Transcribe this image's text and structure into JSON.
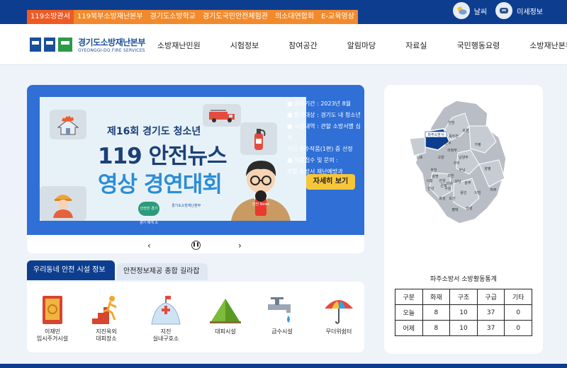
{
  "top_links": [
    "119소방관서",
    "119북부소방재난본부",
    "경기도소방학교",
    "경기도국민안전체험관",
    "의소대연합회",
    "E-교육영상"
  ],
  "weather": {
    "label": "날씨",
    "dust_label": "미세정보"
  },
  "logo": {
    "name": "경기도소방재난본부",
    "english": "GYEONGGI-DO FIRE SERVICES"
  },
  "nav": [
    "소방재난민원",
    "시험정보",
    "참여공간",
    "알림마당",
    "자료실",
    "국민행동요령",
    "소방재난본부소개"
  ],
  "banner": {
    "title_line1": "제16회 경기도 청소년",
    "title_line2": "119 안전뉴스",
    "title_line3": "영상 경연대회",
    "badge": "안전한 경기 경기 에게 소",
    "poster_logo": "경기도소방재난본부",
    "mic_label": "안전 News",
    "info": [
      "■ 공모기간 : 2023년 8월",
      "■ 참가대상 : 경기도 내 청소년",
      "■ 시상내역 : 관할 소방서별 심사",
      "   거친 우수작품(1편) 중 선정",
      "■ 작품접수 및 문의 :",
      "   관할 소방서 재난예방과"
    ],
    "more_button": "자세히 보기",
    "prev": "‹",
    "next": "›"
  },
  "tabs": [
    "우리동네 안전 시설 정보",
    "안전정보제공 종합 길라잡이"
  ],
  "facilities": [
    {
      "label": "이재민\n임시주거시설",
      "icon": "shelter-door-icon"
    },
    {
      "label": "지진옥외\n대피장소",
      "icon": "earthquake-run-icon"
    },
    {
      "label": "지진\n실내구호소",
      "icon": "relief-tent-icon"
    },
    {
      "label": "대피시설",
      "icon": "evacuation-tent-icon"
    },
    {
      "label": "급수시설",
      "icon": "water-tap-icon"
    },
    {
      "label": "무더위쉼터",
      "icon": "umbrella-icon"
    }
  ],
  "map_labels": [
    "파주소방서",
    "연천",
    "포천",
    "동두천",
    "가평",
    "양주",
    "의정부",
    "남양주",
    "구리",
    "하남",
    "고양",
    "김포",
    "부천",
    "광명",
    "안양",
    "과천",
    "성남",
    "광주",
    "양평",
    "여주",
    "이천",
    "용인",
    "수원",
    "화성",
    "오산",
    "평택",
    "안성",
    "시흥",
    "안산",
    "군포",
    "의왕"
  ],
  "stats": {
    "title": "파주소방서 소방활동통계",
    "headers": [
      "구분",
      "화재",
      "구조",
      "구급",
      "기타"
    ],
    "rows": [
      [
        "오늘",
        "8",
        "10",
        "37",
        "0"
      ],
      [
        "어제",
        "8",
        "10",
        "37",
        "0"
      ]
    ]
  },
  "colors": {
    "navy": "#0d3d8e",
    "orange": "#f28a2c",
    "banner_blue": "#2f6fd6",
    "button_yellow": "#f6c63a"
  }
}
